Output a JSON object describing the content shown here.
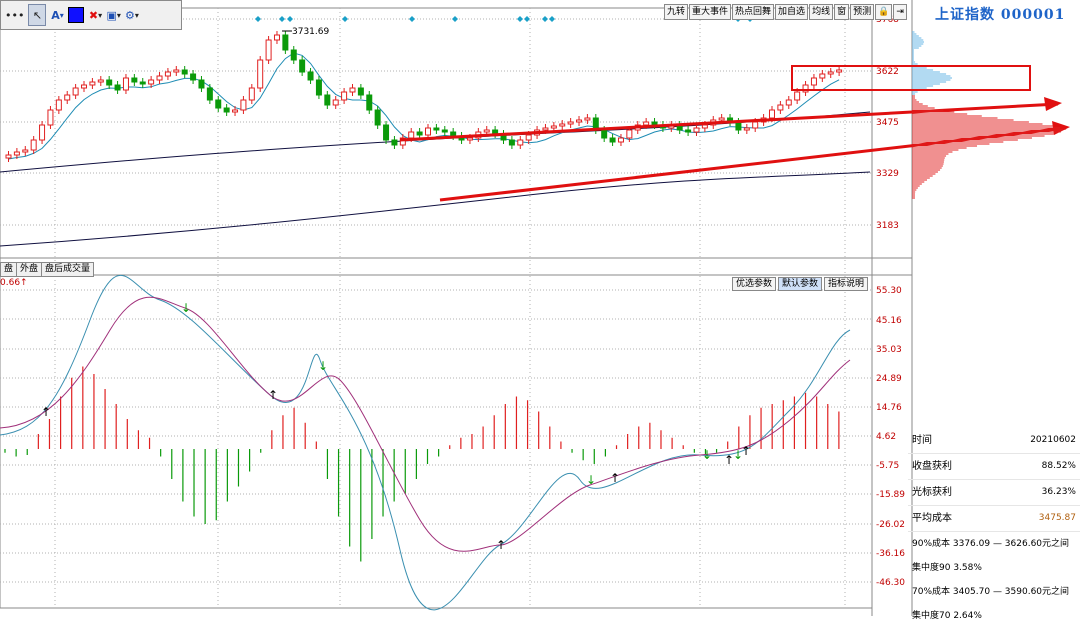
{
  "toolbar": {
    "more": "•••",
    "text_tool": "A",
    "dropdown_arrow": "▾",
    "icons": [
      "cursor-icon",
      "text-icon",
      "color-swatch-icon",
      "delete-x-icon",
      "save-icon",
      "gear-icon"
    ],
    "colors": {
      "swatch": "#1010ff",
      "delete": "#e01010",
      "gear": "#1e50b4"
    }
  },
  "top_buttons": [
    "九转",
    "重大事件",
    "热点回舞",
    "加自选",
    "均线",
    "窗",
    "预测"
  ],
  "index_title": "上证指数 000001",
  "price_axis": {
    "labels": [
      "3768",
      "3622",
      "3475",
      "3329",
      "3183"
    ]
  },
  "annotation": {
    "high_label": "3731.69"
  },
  "tabs": [
    "盘",
    "外盘",
    "盘后成交量"
  ],
  "macd": {
    "value_label": "0.66",
    "value_arrow": "↑",
    "buttons": [
      "优选参数",
      "默认参数",
      "指标说明"
    ],
    "axis_labels": [
      "55.30",
      "45.16",
      "35.03",
      "24.89",
      "14.76",
      "4.62",
      "-5.75",
      "-15.89",
      "-26.02",
      "-36.16",
      "-46.30"
    ]
  },
  "info_panel": {
    "rows": [
      {
        "label": "时间",
        "value": "20210602"
      },
      {
        "label": "收盘获利",
        "value": "88.52%"
      },
      {
        "label": "光标获利",
        "value": "36.23%"
      },
      {
        "label": "平均成本",
        "value": "3475.87"
      }
    ],
    "cost90": "90%成本  3376.09 — 3626.60元之间",
    "conc90": "集中度90   3.58%",
    "cost70": "70%成本  3405.70 — 3590.60元之间",
    "conc70": "集中度70   2.64%"
  },
  "colors": {
    "up": "#e02020",
    "down": "#0a9a0a",
    "ma": "#1e8cb4",
    "longma": "#101040",
    "dif": "#3a8fb0",
    "dea": "#a0307a",
    "grid": "#b0b0b0",
    "axis_text": "#c00000",
    "title": "#1e64c8",
    "highlight_box": "#e01010"
  }
}
